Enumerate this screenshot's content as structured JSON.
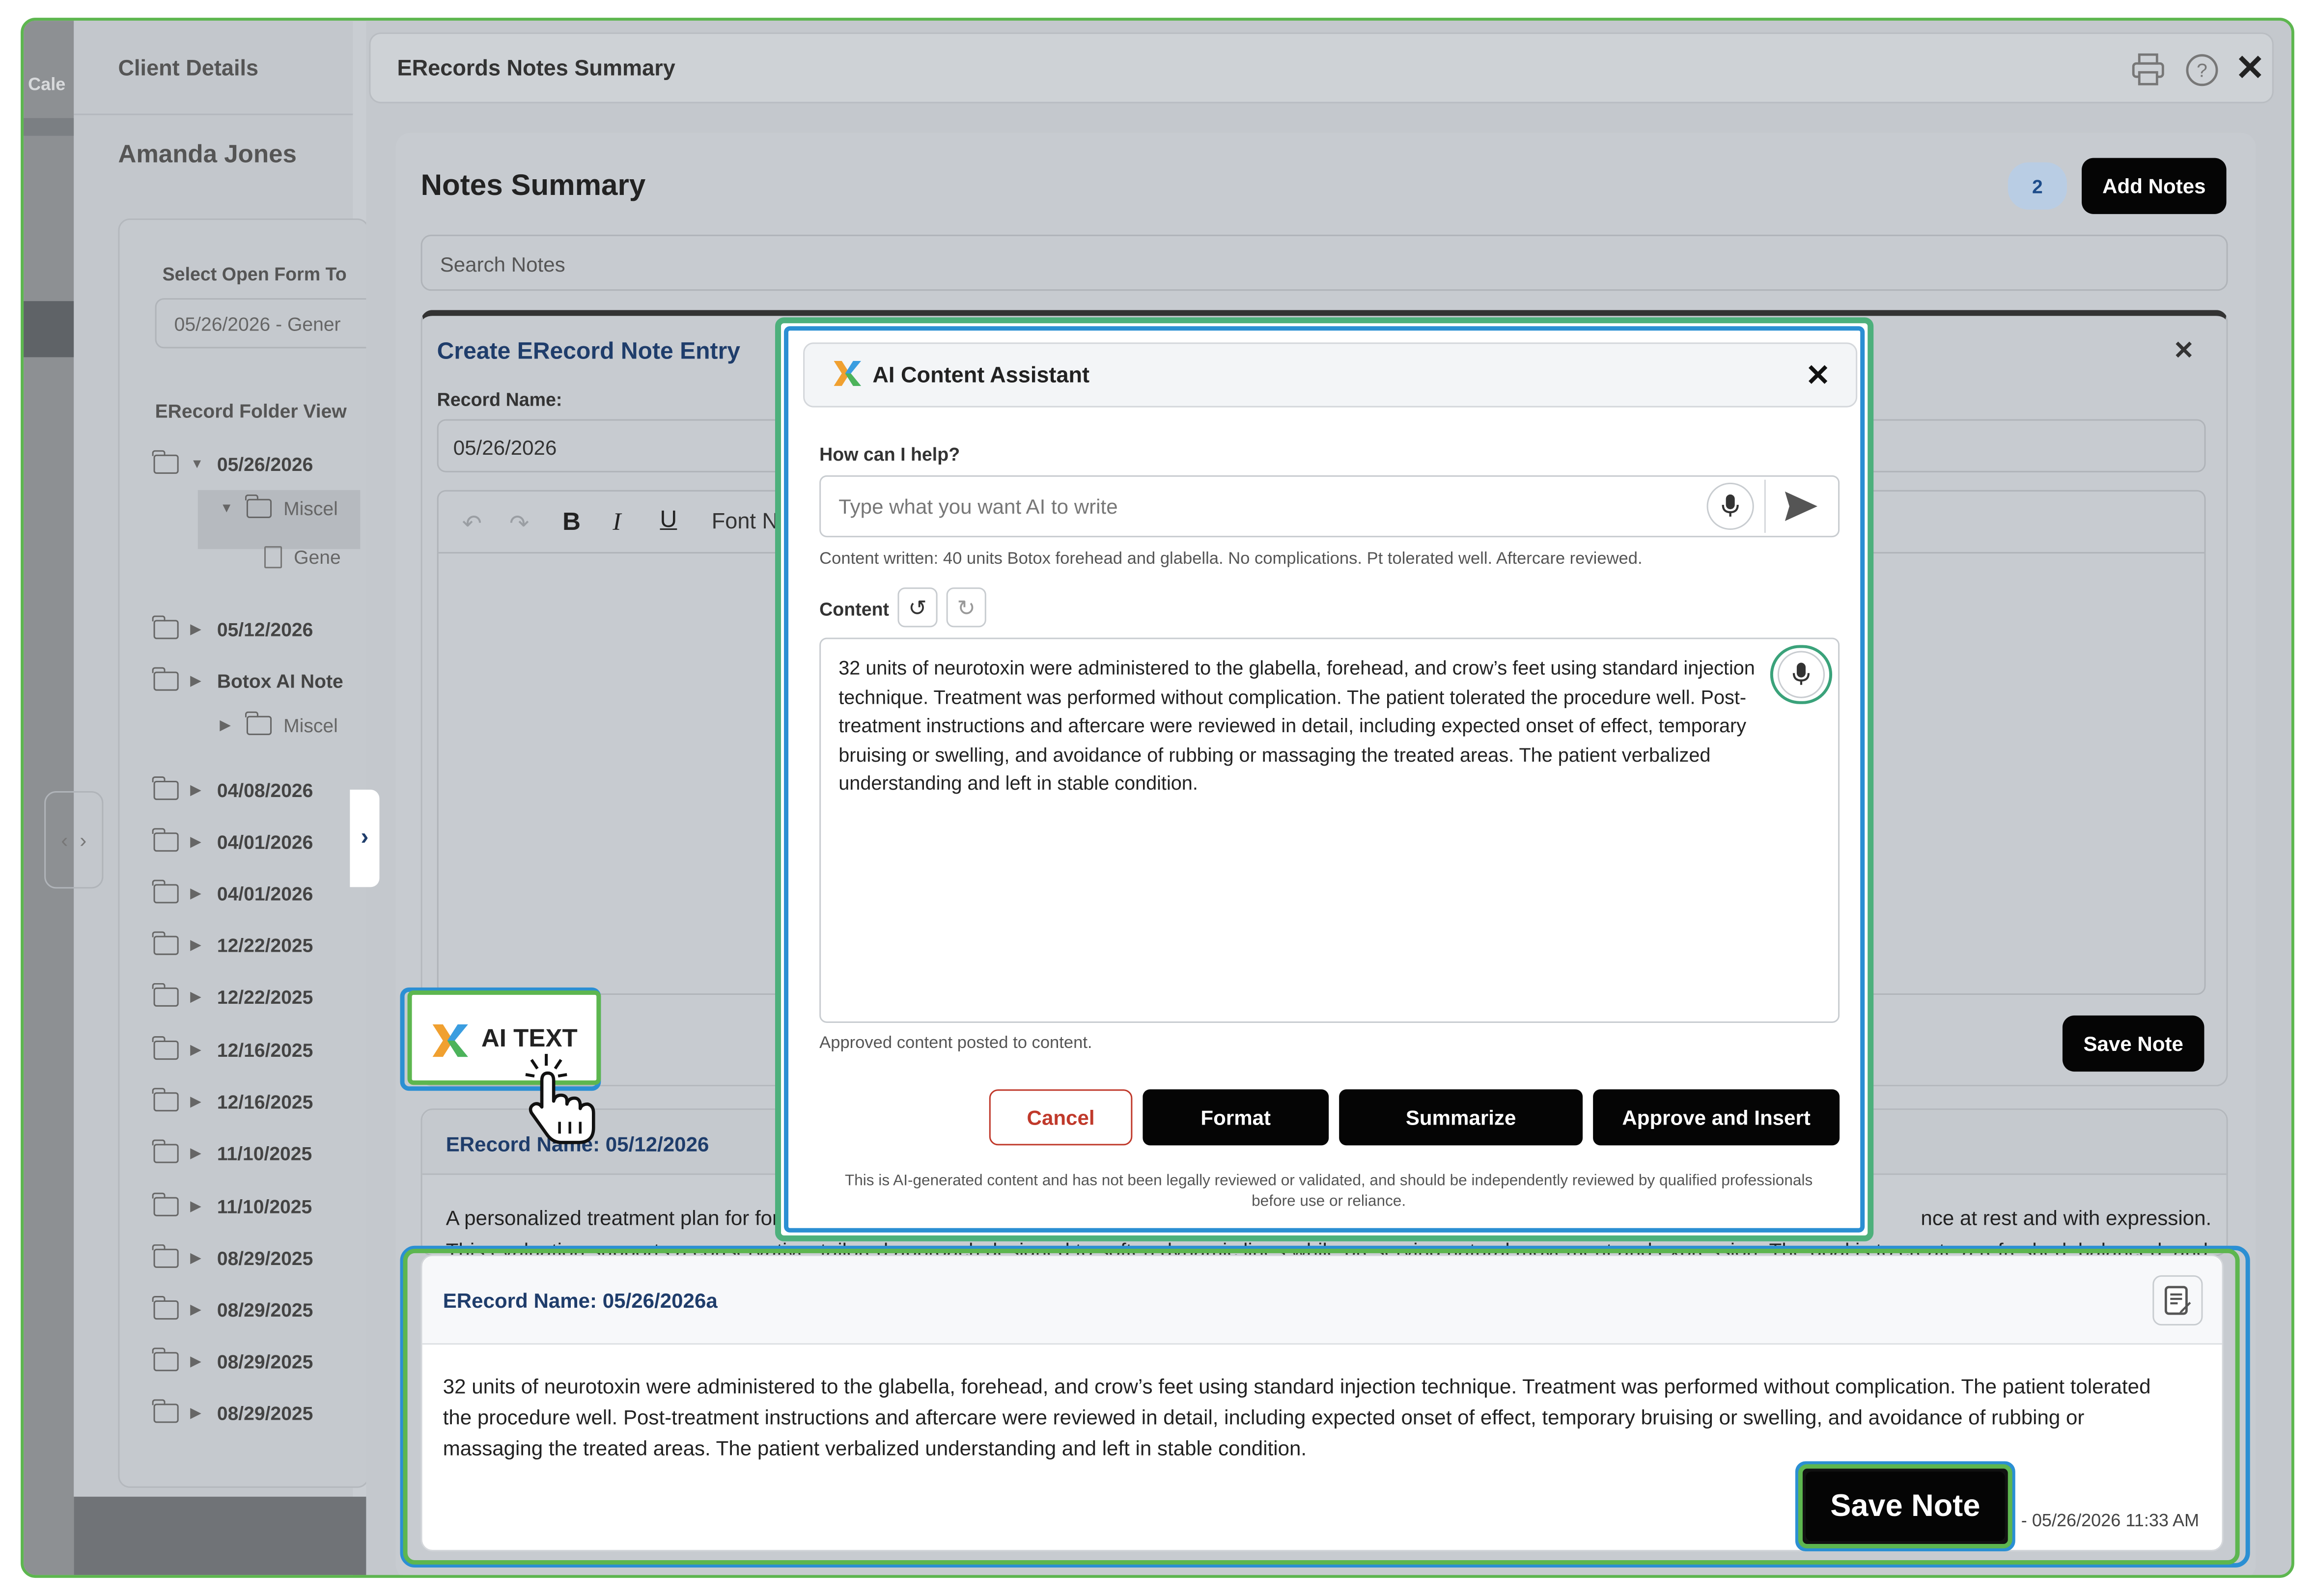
{
  "left_strip": {
    "cal_label": "Cale"
  },
  "sidebar": {
    "title": "Client Details",
    "client_name": "Amanda Jones",
    "select_label": "Select Open Form To",
    "select_value": "05/26/2026 - Gener",
    "folder_view_label": "ERecord Folder View",
    "tree": [
      {
        "label": "05/26/2026",
        "level": 0,
        "expanded": true
      },
      {
        "label": "Miscel",
        "level": 1,
        "expanded": true
      },
      {
        "label": "Gene",
        "level": 2,
        "file": true
      },
      {
        "label": "05/12/2026",
        "level": 0
      },
      {
        "label": "Botox AI Note",
        "level": 0
      },
      {
        "label": "Miscel",
        "level": 1
      },
      {
        "label": "04/08/2026",
        "level": 0
      },
      {
        "label": "04/01/2026",
        "level": 0
      },
      {
        "label": "04/01/2026",
        "level": 0
      },
      {
        "label": "12/22/2025",
        "level": 0
      },
      {
        "label": "12/22/2025",
        "level": 0
      },
      {
        "label": "12/16/2025",
        "level": 0
      },
      {
        "label": "12/16/2025",
        "level": 0
      },
      {
        "label": "11/10/2025",
        "level": 0
      },
      {
        "label": "11/10/2025",
        "level": 0
      },
      {
        "label": "08/29/2025",
        "level": 0
      },
      {
        "label": "08/29/2025",
        "level": 0
      },
      {
        "label": "08/29/2025",
        "level": 0
      },
      {
        "label": "08/29/2025",
        "level": 0
      }
    ]
  },
  "header": {
    "title": "ERecords Notes Summary"
  },
  "notes_summary": {
    "title": "Notes Summary",
    "count": "2",
    "add_button": "Add Notes",
    "search_placeholder": "Search Notes"
  },
  "create_entry": {
    "title": "Create ERecord Note Entry",
    "record_name_label": "Record Name:",
    "record_name_value": "05/26/2026",
    "font_label": "Font N",
    "save_button": "Save Note"
  },
  "ai_text_button": {
    "label": "AI TEXT"
  },
  "ai_modal": {
    "title": "AI Content Assistant",
    "help_label": "How can I help?",
    "prompt_placeholder": "Type what you want AI to write",
    "content_written": "Content written: 40 units Botox forehead and glabella. No complications. Pt tolerated well. Aftercare reviewed.",
    "content_label": "Content",
    "content_text": "32 units of neurotoxin were administered to the glabella, forehead, and crow’s feet using standard injection technique. Treatment was performed without complication. The patient tolerated the procedure well. Post-treatment instructions and aftercare were reviewed in detail, including expected onset of effect, temporary bruising or swelling, and avoidance of rubbing or massaging the treated areas. The patient verbalized understanding and left in stable condition.",
    "status": "Approved content posted to content.",
    "cancel": "Cancel",
    "format": "Format",
    "summarize": "Summarize",
    "approve": "Approve and Insert",
    "disclaimer": "This is AI-generated content and has not been legally reviewed or validated, and should be independently reviewed by qualified professionals before use or reliance."
  },
  "note_1": {
    "title": "ERecord Name: 05/12/2026",
    "text_line1_left": "A personalized treatment plan for for",
    "text_line1_right": "nce at rest and with expression.",
    "text_line2_left": "This evaluation supports a conservati",
    "text_line2_mid": "ve, tailored approach designed to soften dynamic lines while preserving natural movement and expression. The goal is to",
    "text_line2_right": "create a refreshed, balanced, and"
  },
  "note_2": {
    "title": "ERecord Name: 05/26/2026a",
    "text": "32 units of neurotoxin were administered to the glabella, forehead, and crow’s feet using standard injection technique. Treatment was performed without complication. The patient tolerated the procedure well. Post-treatment instructions and aftercare were reviewed in detail, including expected onset of effect, temporary bruising or swelling, and avoidance of rubbing or massaging the treated areas. The patient verbalized understanding and left in stable condition.",
    "save_button": "Save Note",
    "timestamp": "- 05/26/2026 11:33 AM"
  },
  "colors": {
    "highlight_green": "#5db64f",
    "highlight_blue": "#2b8fd3",
    "cancel_red": "#c0392b",
    "count_badge": "#b9cde4"
  }
}
